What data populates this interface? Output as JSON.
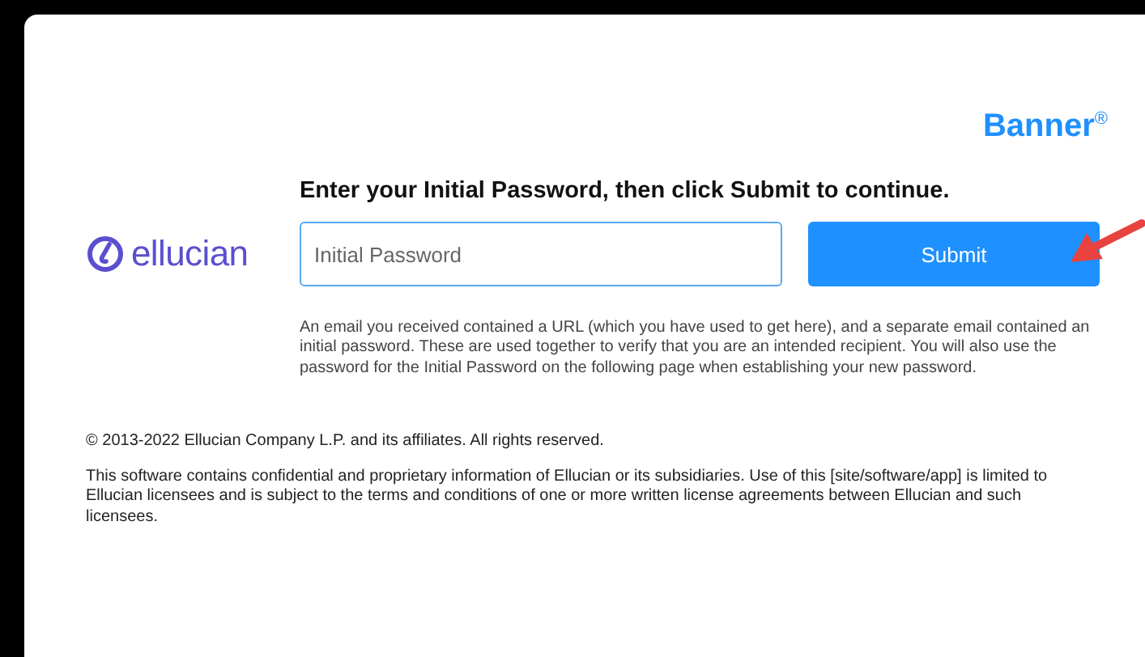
{
  "brand": "Banner$^{®}$",
  "logo": {
    "text": "ellucian"
  },
  "heading": "Enter your Initial Password, then click Submit to continue.",
  "password_field": {
    "placeholder": "Initial Password"
  },
  "submit_button": "Submit",
  "help_text": "An email you received contained a URL (which you have used to get here), and a separate email contained an initial password. These are used together to verify that you are an intended recipient. You will also use the password for the Initial Password on the following page when establishing your new password.",
  "copyright": "© 2013-2022 Ellucian Company L.P. and its affiliates. All rights reserved.",
  "notice": "This software contains confidential and proprietary information of Ellucian or its subsidiaries. Use of this [site/software/app] is limited to Ellucian licensees and is subject to the terms and conditions of one or more written license agreements between Ellucian and such licensees."
}
